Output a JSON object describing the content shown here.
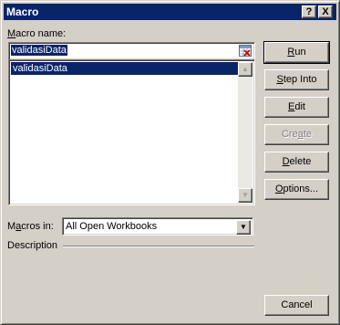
{
  "window": {
    "title": "Macro"
  },
  "titlebar": {
    "help_label": "?",
    "close_label": "X"
  },
  "macro_name": {
    "label_prefix": "",
    "label_accel": "M",
    "label_rest": "acro name:",
    "value": "validasiData"
  },
  "macro_list": {
    "items": [
      "validasiData"
    ]
  },
  "buttons": {
    "run": {
      "accel": "R",
      "rest": "un"
    },
    "step_into": {
      "accel": "S",
      "rest": "tep Into"
    },
    "edit": {
      "accel": "E",
      "rest": "dit"
    },
    "create": {
      "pre": "Cre",
      "accel": "a",
      "rest": "te"
    },
    "delete": {
      "accel": "D",
      "rest": "elete"
    },
    "options": {
      "accel": "O",
      "rest": "ptions..."
    },
    "cancel": "Cancel"
  },
  "macros_in": {
    "label_pre": "M",
    "label_accel": "a",
    "label_rest": "cros in:",
    "value": "All Open Workbooks"
  },
  "description": {
    "label": "Description"
  },
  "colors": {
    "selection": "#0a246a",
    "face": "#d4d0c8",
    "titlebar": "#0a246a"
  }
}
